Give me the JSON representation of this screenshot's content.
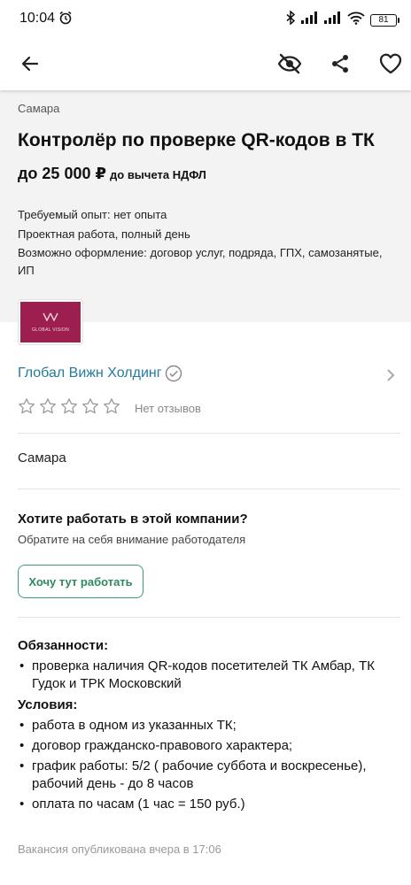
{
  "status_bar": {
    "time": "10:04",
    "battery": "81"
  },
  "toolbar": {
    "icons": [
      "back-arrow-icon",
      "hide-eye-icon",
      "share-icon",
      "heart-icon"
    ]
  },
  "vacancy": {
    "city": "Самара",
    "title": "Контролёр по проверке QR-кодов в ТК",
    "salary": "до 25 000 ₽",
    "salary_note": "до вычета НДФЛ",
    "experience": "Требуемый опыт: нет опыта",
    "schedule": "Проектная работа, полный день",
    "employment": "Возможно оформление: договор услуг, подряда, ГПХ, самозанятые, ИП"
  },
  "company": {
    "logo_text": "GLOBAL VISION",
    "name": "Глобал Вижн Холдинг",
    "rating_stars": 0,
    "reviews": "Нет отзывов",
    "city": "Самара"
  },
  "want_block": {
    "title": "Хотите работать в этой компании?",
    "subtitle": "Обратите на себя внимание работодателя",
    "button": "Хочу тут работать"
  },
  "description": {
    "duties_title": "Обязанности:",
    "duties": [
      "проверка наличия QR-кодов посетителей ТК Амбар, ТК Гудок и ТРК Московский"
    ],
    "conditions_title": "Условия:",
    "conditions": [
      "работа в одном из указанных ТК;",
      "договор гражданско-правового характера;",
      "график работы: 5/2 ( рабочие суббота и воскресенье), рабочий день - до 8 часов",
      "оплата по часам (1 час = 150 руб.)"
    ]
  },
  "published": "Вакансия опубликована вчера в 17:06",
  "colors": {
    "link": "#237b9f",
    "accent_green": "#3c9e6e",
    "logo_bg": "#9c1f4f",
    "header_bg": "#f3f3f3"
  }
}
